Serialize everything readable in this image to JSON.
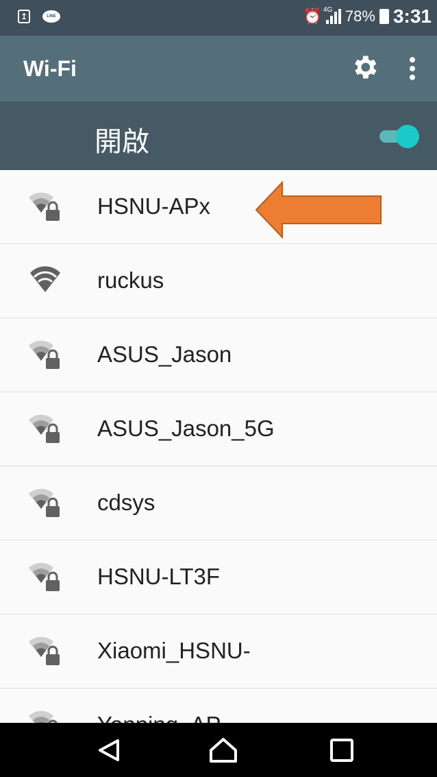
{
  "status_bar": {
    "line_text": "LINE",
    "network_type": "4G",
    "battery": "78%",
    "time": "3:31"
  },
  "app_bar": {
    "title": "Wi-Fi"
  },
  "toggle": {
    "label": "開啟",
    "state": "on"
  },
  "networks": [
    {
      "name": "HSNU-APx",
      "secured": true
    },
    {
      "name": "ruckus",
      "secured": false
    },
    {
      "name": "ASUS_Jason",
      "secured": true
    },
    {
      "name": "ASUS_Jason_5G",
      "secured": true
    },
    {
      "name": "cdsys",
      "secured": true
    },
    {
      "name": "HSNU-LT3F",
      "secured": true
    },
    {
      "name": "Xiaomi_HSNU-",
      "secured": true
    },
    {
      "name": "Yonping_AP",
      "secured": true
    }
  ],
  "colors": {
    "status_bar": "#3f4f5c",
    "app_bar": "#546e7a",
    "toggle_bar": "#455a64",
    "accent": "#1cc9c9",
    "arrow": "#ed7d31"
  },
  "icons": {
    "settings": "gear-icon",
    "more": "more-vert-icon",
    "nav_back": "back-icon",
    "nav_home": "home-icon",
    "nav_recents": "recents-icon"
  }
}
